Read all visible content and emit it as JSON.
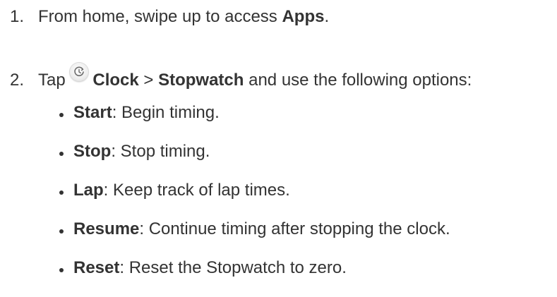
{
  "steps": [
    {
      "number": "1.",
      "prefix": "From home, swipe up to access ",
      "bold": "Apps",
      "suffix": "."
    },
    {
      "number": "2.",
      "prefix": "Tap",
      "icon": "clock-app-icon",
      "bold1": "Clock",
      "separator": " > ",
      "bold2": "Stopwatch",
      "suffix": " and use the following options:"
    }
  ],
  "options": [
    {
      "label": "Start",
      "desc": ": Begin timing."
    },
    {
      "label": "Stop",
      "desc": ": Stop timing."
    },
    {
      "label": "Lap",
      "desc": ": Keep track of lap times."
    },
    {
      "label": "Resume",
      "desc": ": Continue timing after stopping the clock."
    },
    {
      "label": "Reset",
      "desc": ": Reset the Stopwatch to zero."
    }
  ],
  "colors": {
    "text": "#333333",
    "background": "#ffffff"
  }
}
